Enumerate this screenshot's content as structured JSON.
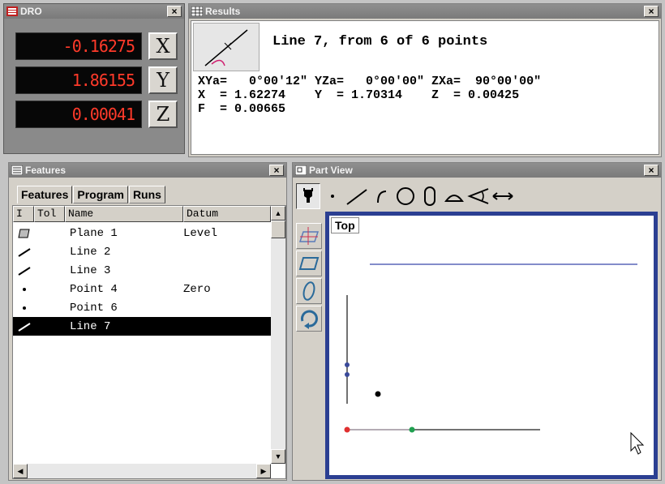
{
  "dro": {
    "title": "DRO",
    "close": "×",
    "rows": [
      {
        "value": "-0.16275",
        "axis": "X"
      },
      {
        "value": "1.86155",
        "axis": "Y"
      },
      {
        "value": "0.00041",
        "axis": "Z"
      }
    ]
  },
  "results": {
    "title": "Results",
    "close": "×",
    "heading": "Line 7, from 6 of 6 points",
    "line1": "XYa=   0°00'12\" YZa=   0°00'00\" ZXa=  90°00'00\"",
    "line2": "X  = 1.62274    Y  = 1.70314    Z  = 0.00425",
    "line3": "F  = 0.00665"
  },
  "features": {
    "title": "Features",
    "close": "×",
    "tabs": [
      "Features",
      "Program",
      "Runs"
    ],
    "columns": [
      "I",
      "Tol",
      "Name",
      "Datum"
    ],
    "rows": [
      {
        "icon": "plane-icon",
        "name": "Plane 1",
        "datum": "Level",
        "selected": false
      },
      {
        "icon": "line-icon",
        "name": "Line 2",
        "datum": "",
        "selected": false
      },
      {
        "icon": "line-icon",
        "name": "Line 3",
        "datum": "",
        "selected": false
      },
      {
        "icon": "point-icon",
        "name": "Point 4",
        "datum": "Zero",
        "selected": false
      },
      {
        "icon": "point-icon",
        "name": "Point 6",
        "datum": "",
        "selected": false
      },
      {
        "icon": "line-icon",
        "name": "Line 7",
        "datum": "",
        "selected": true
      }
    ]
  },
  "partview": {
    "title": "Part View",
    "close": "×",
    "view_label": "Top",
    "toolbar_icons": [
      "probe-icon",
      "point-tool-icon",
      "line-tool-icon",
      "arc-tool-icon",
      "circle-tool-icon",
      "slot-tool-icon",
      "half-circle-tool-icon",
      "angle-tool-icon",
      "distance-tool-icon"
    ],
    "sidebar_icons": [
      "plane-view-icon",
      "rectangle-tool-icon",
      "ellipse-tool-icon",
      "rotate-view-icon"
    ],
    "colors": {
      "frame": "#2b3f92",
      "line": "#5a66b8",
      "origin": "#e03030",
      "green": "#20a050"
    }
  },
  "colors": {
    "dro_text": "#ff3a2a",
    "title_bar": "#808080",
    "selection": "#000000"
  }
}
